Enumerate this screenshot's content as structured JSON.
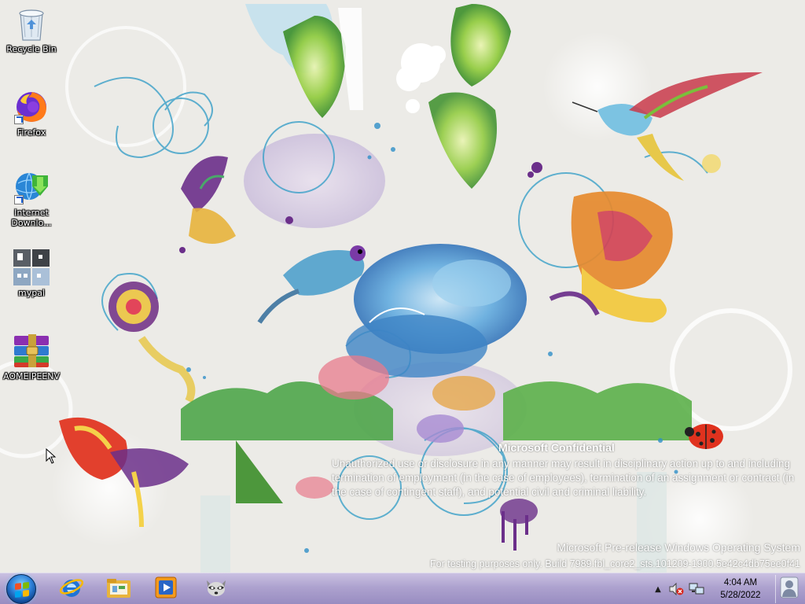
{
  "desktop": {
    "icons": [
      {
        "label": "Recycle Bin",
        "icon": "recycle-bin-icon"
      },
      {
        "label": "Firefox",
        "icon": "firefox-icon"
      },
      {
        "label": "Internet Downlo...",
        "icon": "internet-download-manager-icon"
      },
      {
        "label": "mypal",
        "icon": "mypal-icon"
      },
      {
        "label": "AOMEIPEENV",
        "icon": "winrar-archive-icon"
      }
    ]
  },
  "watermark": {
    "title": "Microsoft Confidential",
    "body": "Unauthorized use or disclosure in any manner may result in disciplinary action up to and including termination of employment (in the case of employees), termination of an assignment or contract (in the case of contingent staff), and potential civil and criminal liability.",
    "os": "Microsoft Pre-release Windows Operating System",
    "build": "For testing purposes only. Build 7989.fbl_core2_sts.101209-1900.5e42c4db75ee0f41"
  },
  "taskbar": {
    "start_icon": "windows-orb-icon",
    "pinned": [
      {
        "name": "internet-explorer",
        "icon": "internet-explorer-icon"
      },
      {
        "name": "windows-explorer",
        "icon": "folder-library-icon"
      },
      {
        "name": "media-player",
        "icon": "media-player-icon"
      },
      {
        "name": "raccoon-app",
        "icon": "raccoon-icon"
      }
    ],
    "tray": {
      "chevron_icon": "show-hidden-icons-chevron",
      "volume_icon": "volume-muted-icon",
      "network_icon": "network-icon",
      "time": "4:04 AM",
      "date": "5/28/2022",
      "user_icon": "user-account-icon"
    }
  },
  "colors": {
    "taskbar": "#a99ecb",
    "wallpaper_base": "#ecebe7"
  }
}
